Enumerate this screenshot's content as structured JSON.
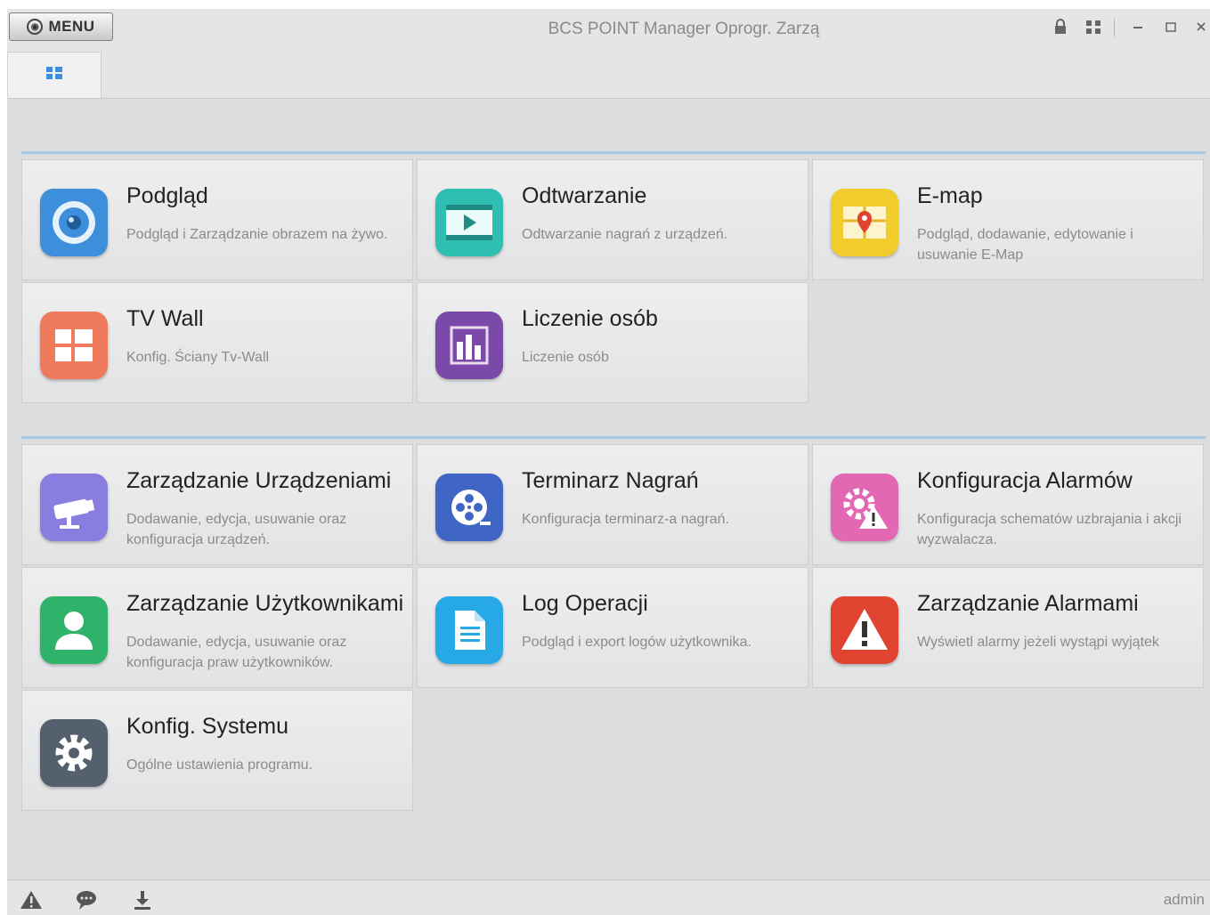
{
  "titlebar": {
    "menu_label": "MENU",
    "app_title": "BCS POINT Manager Oprogr. Zarzą"
  },
  "tabbar": {
    "home_icon": "home-grid-icon"
  },
  "sections": [
    {
      "name": "operation",
      "cards": [
        {
          "id": "podglad",
          "title": "Podgląd",
          "desc": "Podgląd i Zarządzanie obrazem na żywo.",
          "icon": "live-view-icon",
          "color": "#3d8fdc"
        },
        {
          "id": "odtwarzanie",
          "title": "Odtwarzanie",
          "desc": "Odtwarzanie nagrań z urządzeń.",
          "icon": "playback-icon",
          "color": "#2fbfb2"
        },
        {
          "id": "emap",
          "title": "E-map",
          "desc": "Podgląd, dodawanie, edytowanie i usuwanie E-Map",
          "icon": "emap-icon",
          "color": "#f0cc2c"
        },
        {
          "id": "tvwall",
          "title": "TV Wall",
          "desc": "Konfig. Ściany Tv-Wall",
          "icon": "tv-wall-icon",
          "color": "#ef7a5c"
        },
        {
          "id": "liczenie",
          "title": "Liczenie osób",
          "desc": "Liczenie osób",
          "icon": "people-counting-icon",
          "color": "#7b4aa8"
        }
      ]
    },
    {
      "name": "management",
      "cards": [
        {
          "id": "urzadzenia",
          "title": "Zarządzanie Urządzeniami",
          "desc": "Dodawanie, edycja, usuwanie oraz konfiguracja urządzeń.",
          "icon": "camera-device-icon",
          "color": "#8a7de0"
        },
        {
          "id": "terminarz",
          "title": "Terminarz Nagrań",
          "desc": "Konfiguracja terminarz-a nagrań.",
          "icon": "film-reel-icon",
          "color": "#3f66c4"
        },
        {
          "id": "konfalarm",
          "title": "Konfiguracja Alarmów",
          "desc": "Konfiguracja schematów uzbrajania i akcji wyzwalacza.",
          "icon": "alarm-config-icon",
          "color": "#e368b4"
        },
        {
          "id": "uzytkownicy",
          "title": "Zarządzanie Użytkownikami",
          "desc": "Dodawanie, edycja, usuwanie oraz konfiguracja praw użytkowników.",
          "icon": "user-icon",
          "color": "#2fb36a"
        },
        {
          "id": "log",
          "title": "Log Operacji",
          "desc": "Podgląd i export logów użytkownika.",
          "icon": "log-document-icon",
          "color": "#27a9e6"
        },
        {
          "id": "alarmy",
          "title": "Zarządzanie Alarmami",
          "desc": "Wyświetl alarmy jeżeli wystąpi wyjątek",
          "icon": "alarm-warning-icon",
          "color": "#e0432f"
        },
        {
          "id": "system",
          "title": "Konfig. Systemu",
          "desc": "Ogólne ustawienia programu.",
          "icon": "system-gear-icon",
          "color": "#54606e"
        }
      ]
    }
  ],
  "statusbar": {
    "user": "admin",
    "icons": [
      "alarm-icon",
      "message-icon",
      "download-icon"
    ]
  }
}
